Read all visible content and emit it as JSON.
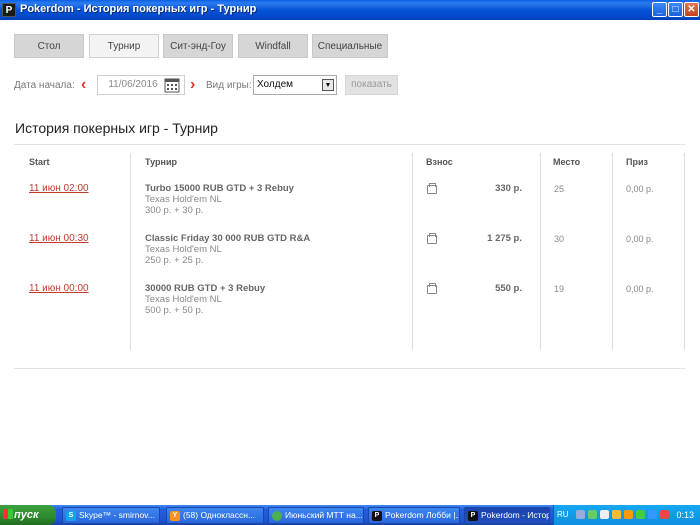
{
  "window": {
    "app_icon": "P",
    "title": "Pokerdom - История покерных игр - Турнир"
  },
  "tabs": [
    {
      "label": "Стол",
      "active": false
    },
    {
      "label": "Турнир",
      "active": true
    },
    {
      "label": "Сит-энд-Гоу",
      "active": false
    },
    {
      "label": "Windfall",
      "active": false
    },
    {
      "label": "Специальные",
      "active": false
    }
  ],
  "filters": {
    "start_date_label": "Дата начала:",
    "date_value": "11/06/2016",
    "game_type_label": "Вид игры:",
    "game_type_value": "Холдем",
    "show_button": "показать"
  },
  "page_title": "История покерных игр - Турнир",
  "table": {
    "headers": {
      "start": "Start",
      "tournament": "Турнир",
      "fee": "Взнос",
      "place": "Место",
      "prize": "Приз"
    },
    "rows": [
      {
        "start": "11 июн 02:00",
        "name": "Turbo 15000 RUB GTD + 3 Rebuy",
        "game": "Texas Hold'em NL",
        "buyin": "300 р. + 30 р.",
        "fee": "330 р.",
        "place": "25",
        "prize": "0,00 р."
      },
      {
        "start": "11 июн 00:30",
        "name": "Classic Friday 30 000 RUB GTD R&A",
        "game": "Texas Hold'em NL",
        "buyin": "250 р. + 25 р.",
        "fee": "1 275 р.",
        "place": "30",
        "prize": "0,00 р."
      },
      {
        "start": "11 июн 00:00",
        "name": "30000 RUB GTD + 3 Rebuy",
        "game": "Texas Hold'em NL",
        "buyin": "500 р. + 50 р.",
        "fee": "550 р.",
        "place": "19",
        "prize": "0,00 р."
      }
    ]
  },
  "taskbar": {
    "start_label": "пуск",
    "tasks": [
      {
        "label": "Skype™ - smirnov...",
        "icon": "skype-icon",
        "color": "#1aa0e6"
      },
      {
        "label": "(58) Одноклассн...",
        "icon": "odnoklassniki-icon",
        "color": "#f7931e"
      },
      {
        "label": "Июньский МТТ на...",
        "icon": "chrome-icon",
        "color": "#4caf50"
      },
      {
        "label": "Pokerdom Лобби |...",
        "icon": "pokerdom-icon",
        "color": "#111111"
      },
      {
        "label": "Pokerdom - Истор...",
        "icon": "pokerdom-icon",
        "color": "#111111"
      }
    ],
    "lang": "RU",
    "clock": "0:13"
  }
}
